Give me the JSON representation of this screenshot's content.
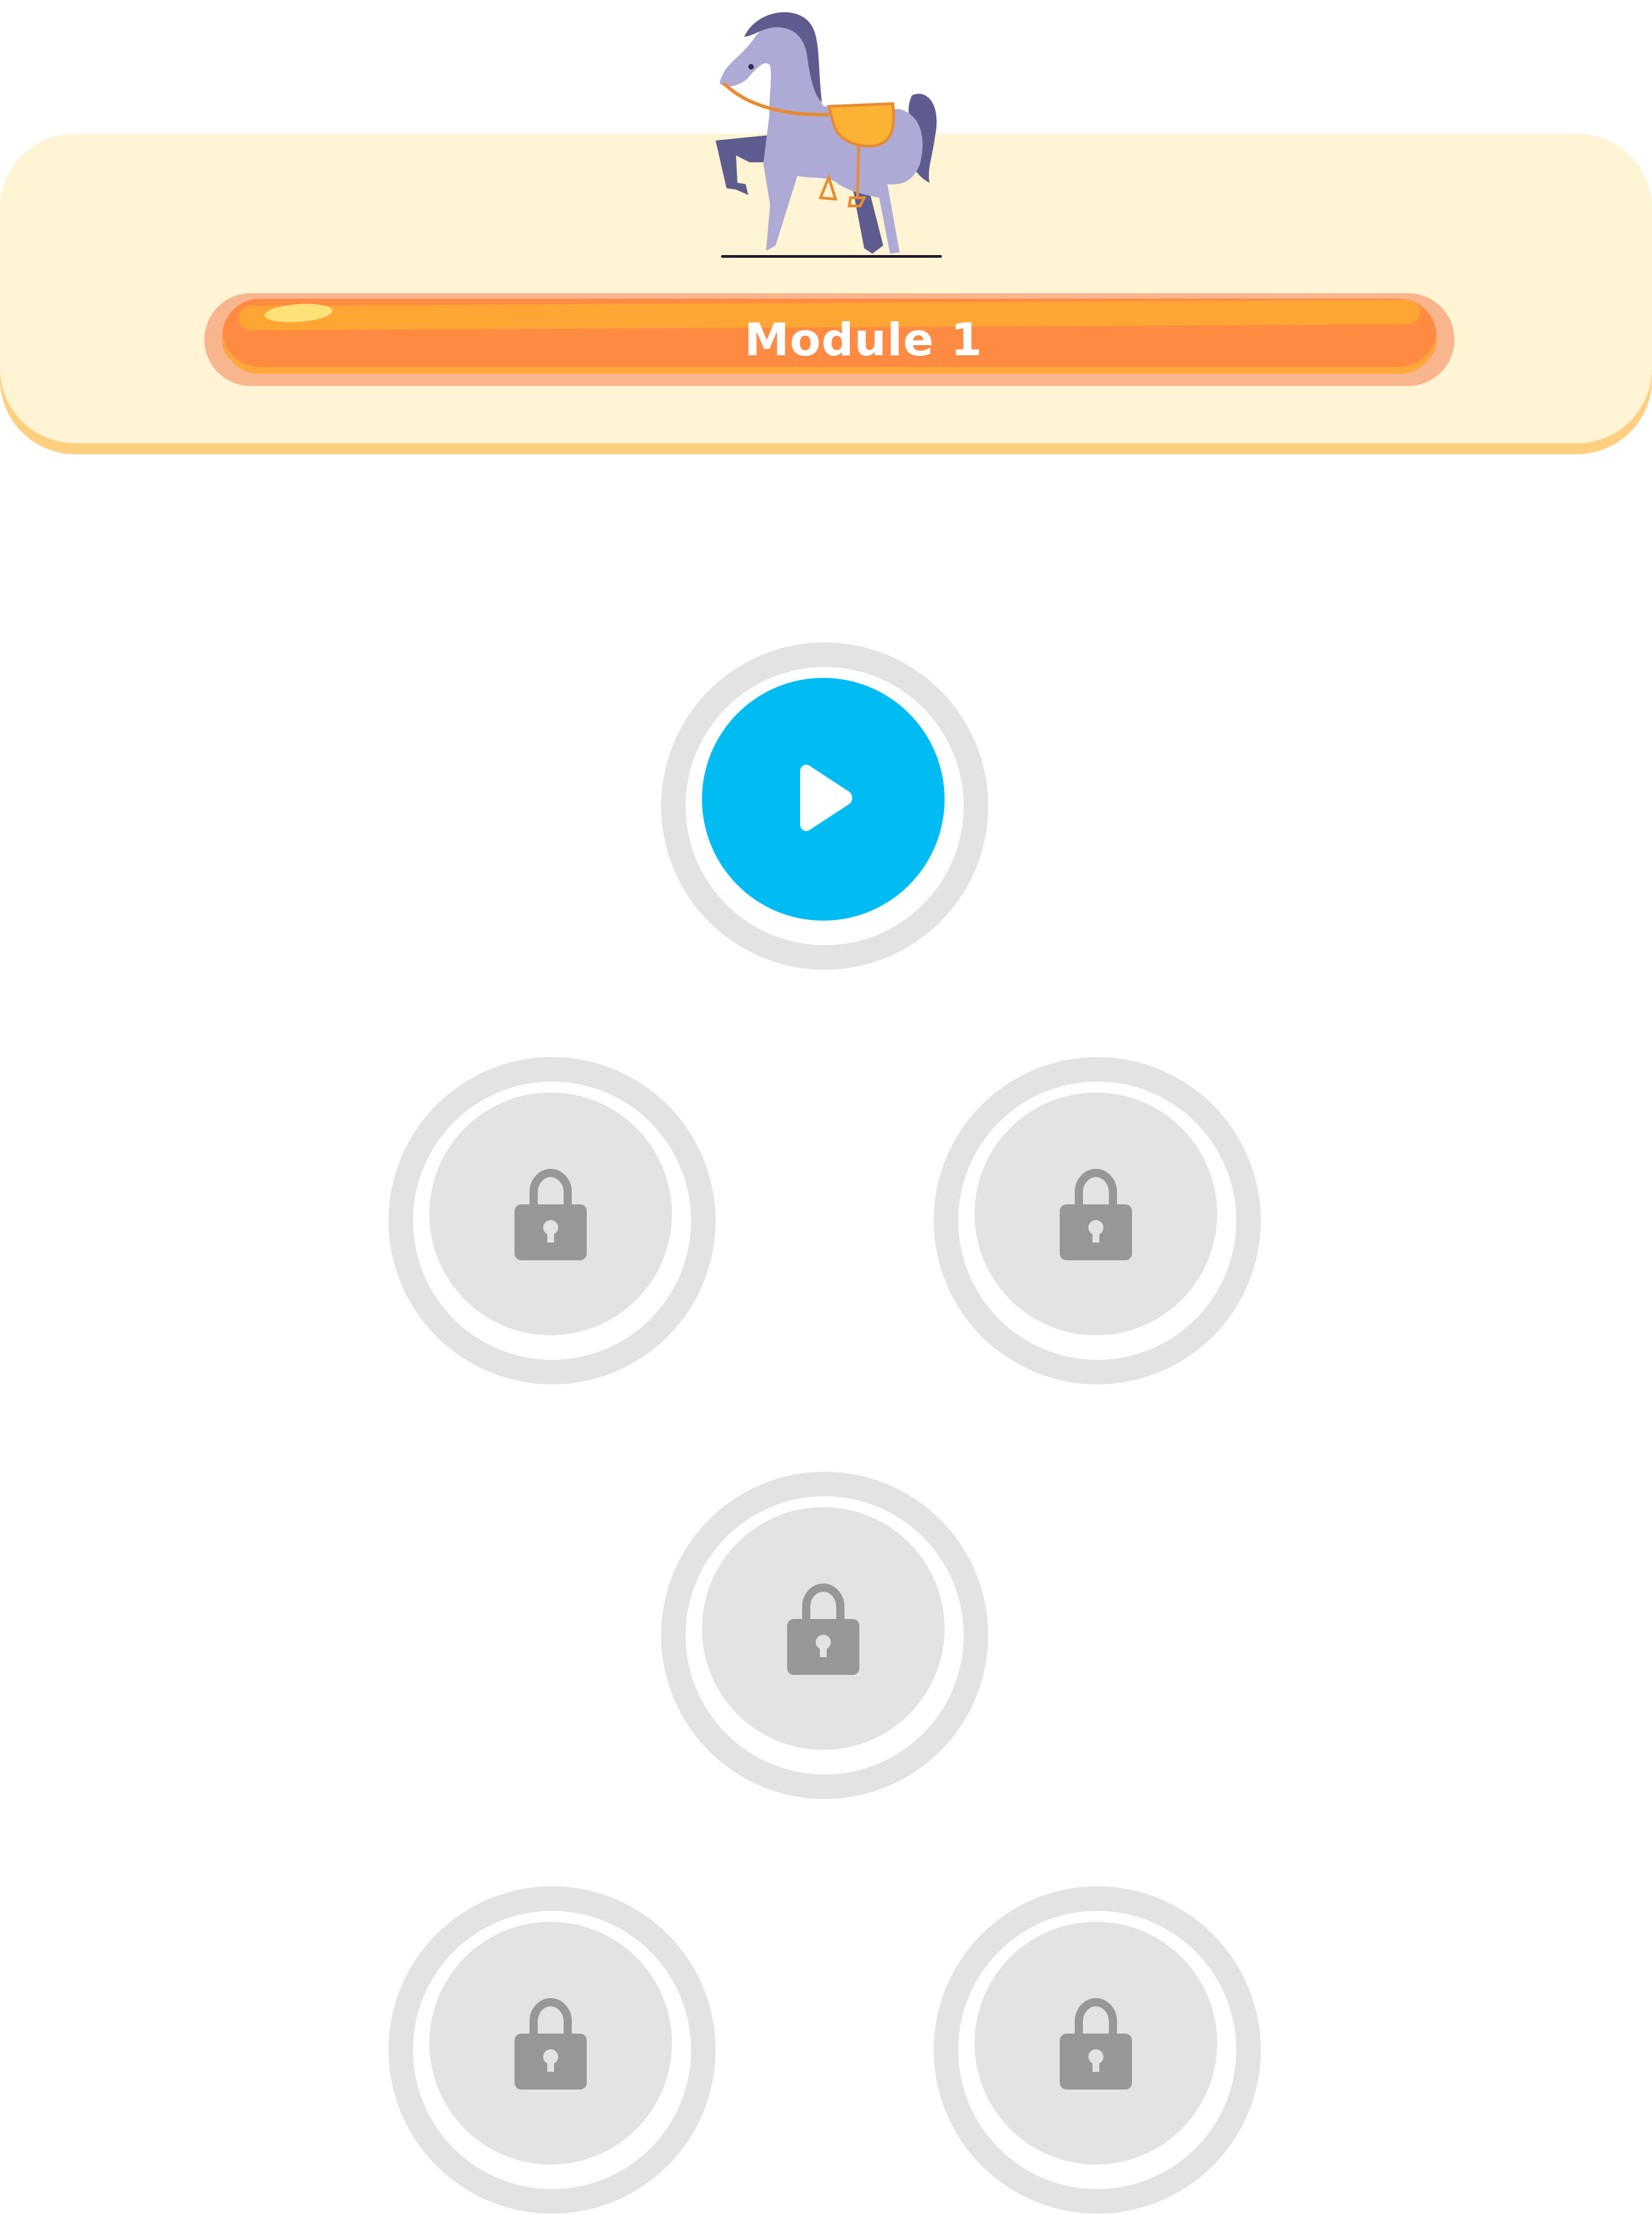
{
  "header": {
    "module_title": "Module 1",
    "mascot_icon": "horse-illustration",
    "background_color": "#FFF4D3",
    "banner_color": "#FF8B43"
  },
  "lessons": [
    {
      "state": "active",
      "icon": "play-icon",
      "color": "#00BCF2"
    },
    {
      "state": "locked",
      "icon": "lock-icon"
    },
    {
      "state": "locked",
      "icon": "lock-icon"
    },
    {
      "state": "locked",
      "icon": "lock-icon"
    },
    {
      "state": "locked",
      "icon": "lock-icon"
    },
    {
      "state": "locked",
      "icon": "lock-icon"
    }
  ]
}
